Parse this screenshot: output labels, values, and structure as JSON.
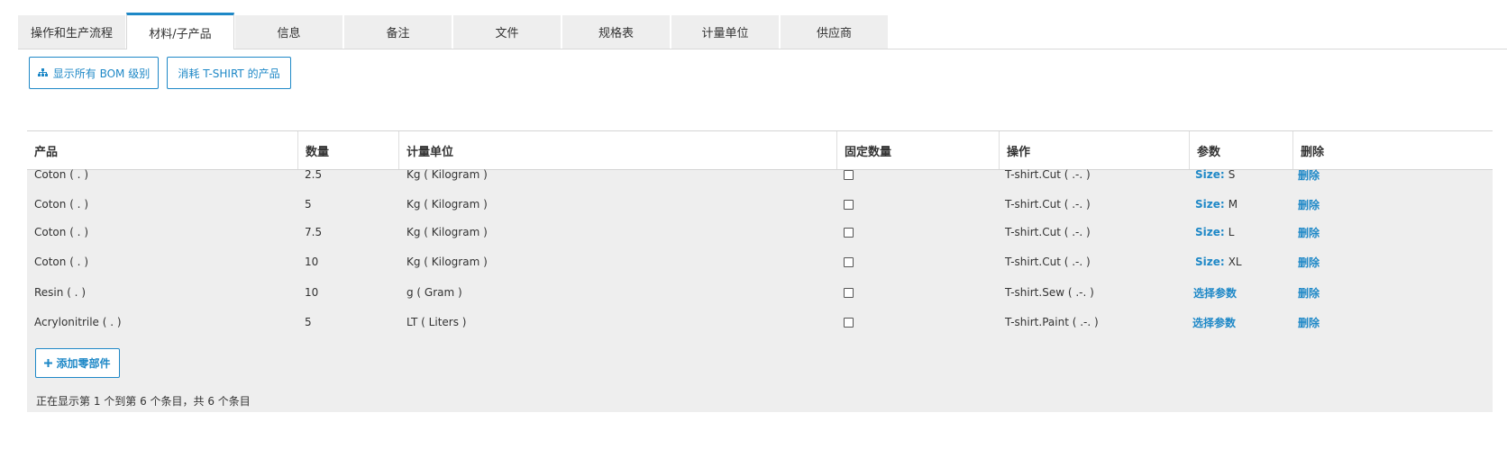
{
  "tabs": [
    {
      "label": "操作和生产流程",
      "active": false
    },
    {
      "label": "材料/子产品",
      "active": true
    },
    {
      "label": "信息",
      "active": false
    },
    {
      "label": "备注",
      "active": false
    },
    {
      "label": "文件",
      "active": false
    },
    {
      "label": "规格表",
      "active": false
    },
    {
      "label": "计量单位",
      "active": false
    },
    {
      "label": "供应商",
      "active": false
    }
  ],
  "toolbar": {
    "show_bom_label": "显示所有 BOM 级别",
    "show_bom_icon": "sitemap-icon",
    "consume_label": "消耗 T-SHIRT 的产品"
  },
  "table": {
    "headers": [
      "产品",
      "数量",
      "计量单位",
      "固定数量",
      "操作",
      "参数",
      "删除"
    ],
    "rows": [
      {
        "product": "Coton ( . )",
        "qty": "2.5",
        "uom": "Kg ( Kilogram )",
        "fixed": false,
        "operation": "T-shirt.Cut ( .-. )",
        "param_key": "Size:",
        "param_val": "S",
        "delete": "删除"
      },
      {
        "product": "Coton ( . )",
        "qty": "5",
        "uom": "Kg ( Kilogram )",
        "fixed": false,
        "operation": "T-shirt.Cut ( .-. )",
        "param_key": "Size:",
        "param_val": "M",
        "delete": "删除"
      },
      {
        "product": "Coton ( . )",
        "qty": "7.5",
        "uom": "Kg ( Kilogram )",
        "fixed": false,
        "operation": "T-shirt.Cut ( .-. )",
        "param_key": "Size:",
        "param_val": "L",
        "delete": "删除"
      },
      {
        "product": "Coton ( . )",
        "qty": "10",
        "uom": "Kg ( Kilogram )",
        "fixed": false,
        "operation": "T-shirt.Cut ( .-. )",
        "param_key": "Size:",
        "param_val": "XL",
        "delete": "删除"
      },
      {
        "product": "Resin ( . )",
        "qty": "10",
        "uom": "g ( Gram )",
        "fixed": false,
        "operation": "T-shirt.Sew ( .-. )",
        "param_key": "选择参数",
        "param_val": "",
        "delete": "删除"
      },
      {
        "product": "Acrylonitrile ( . )",
        "qty": "5",
        "uom": "LT ( Liters )",
        "fixed": false,
        "operation": "T-shirt.Paint ( .-. )",
        "param_key": "选择参数",
        "param_val": "",
        "delete": "删除"
      }
    ],
    "add_label": "添加零部件"
  },
  "footer": {
    "summary": "正在显示第 1 个到第 6 个条目，共 6 个条目"
  },
  "colors": {
    "accent": "#1e88c7",
    "tab_bg": "#eeeeee",
    "table_bg": "#eeeeee"
  }
}
